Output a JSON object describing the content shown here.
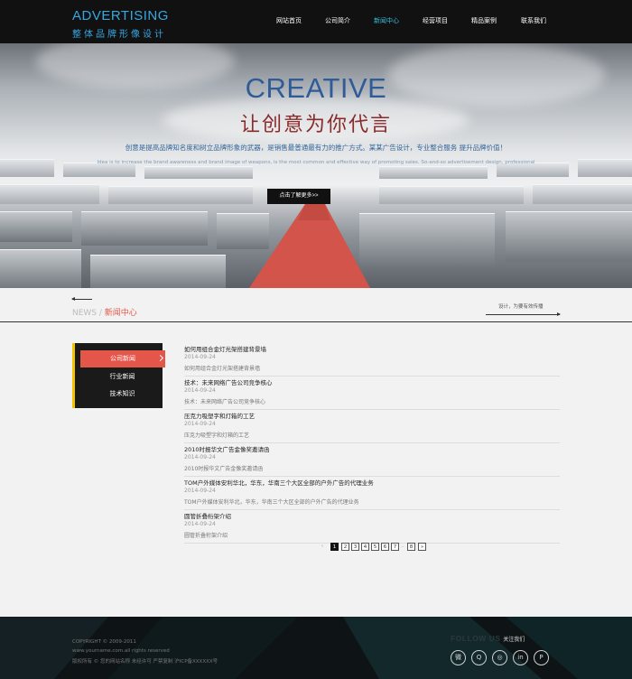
{
  "header": {
    "logo_title": "ADVERTISING",
    "logo_sub": "整体品牌形像设计",
    "nav": [
      {
        "label": "网站首页",
        "active": false
      },
      {
        "label": "公司简介",
        "active": false
      },
      {
        "label": "新闻中心",
        "active": true
      },
      {
        "label": "经营项目",
        "active": false
      },
      {
        "label": "精品案例",
        "active": false
      },
      {
        "label": "联系我们",
        "active": false
      }
    ]
  },
  "banner": {
    "title": "CREATIVE",
    "subtitle": "让创意为你代言",
    "desc": "创意是提高品牌知名度和树立品牌形象的武器，是销售最普通最有力的推广方式。某某广告设计，专业整合服务  提升品牌价值！",
    "desc_en": "Idea is to increase the brand awareness and brand image of weapons, is the most common and effective way of promoting sales. So-and-so advertisement design, professional",
    "button": "点击了解更多>>"
  },
  "section": {
    "en": "NEWS",
    "sep": " / ",
    "cn": "新闻中心",
    "right_text": "设计，为要有效传播"
  },
  "sidebar": {
    "items": [
      {
        "label": "公司新闻",
        "active": true
      },
      {
        "label": "行业新闻",
        "active": false
      },
      {
        "label": "技术知识",
        "active": false
      }
    ]
  },
  "news": [
    {
      "title": "如何用组合金灯光架搭建背景墙",
      "date": "2014-09-24",
      "desc": "如何用组合金灯光架搭建背景墙"
    },
    {
      "title": "技术：未来网络广告公司竞争核心",
      "date": "2014-09-24",
      "desc": "技术：未来网络广告公司竞争核心"
    },
    {
      "title": "压克力吸塑字和灯箱的工艺",
      "date": "2014-09-24",
      "desc": "压克力吸塑字和灯箱的工艺"
    },
    {
      "title": "2010时报华文广告金像奖邀请函",
      "date": "2014-09-24",
      "desc": "2010时报华文广告金像奖邀请函"
    },
    {
      "title": "TOM户外媒体安利华北，华东，华南三个大区全部的户外广告的代理业务",
      "date": "2014-09-24",
      "desc": "TOM户外媒体安利华北，华东，华南三个大区全部的户外广告的代理业务"
    },
    {
      "title": "圆管折叠桁架介绍",
      "date": "2014-09-24",
      "desc": "圆管折叠桁架介绍"
    }
  ],
  "pagination": {
    "prev": "‹",
    "pages": [
      "1",
      "2",
      "3",
      "4",
      "5",
      "6",
      "7"
    ],
    "ellipsis": "..",
    "last": "8",
    "next": "»",
    "current": "1"
  },
  "footer": {
    "copyright": "COPYRIGHT © 2009-2011",
    "rights": "www.yourname.com.all rights reserved",
    "notice": "版权所有 © 您的网站名称 未经许可 严禁复制  沪ICP备XXXXXX号",
    "follow_en": "FOLLOW US",
    "follow_cn": "关注我们",
    "social": [
      {
        "name": "weibo-icon",
        "glyph": "微"
      },
      {
        "name": "qq-icon",
        "glyph": "Q"
      },
      {
        "name": "wechat-icon",
        "glyph": "◎"
      },
      {
        "name": "linkedin-icon",
        "glyph": "in"
      },
      {
        "name": "pinterest-icon",
        "glyph": "P"
      }
    ]
  },
  "colors": {
    "accent_blue": "#38a7e0",
    "accent_red": "#e5564a",
    "accent_yellow": "#f3c400",
    "header_bg": "#111111",
    "footer_bg": "#0e1416"
  }
}
